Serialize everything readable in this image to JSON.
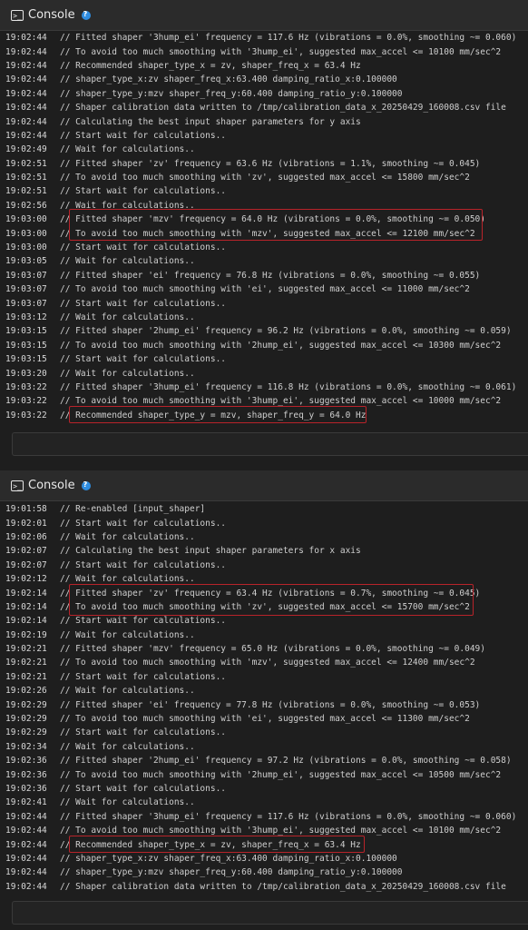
{
  "panel1": {
    "title": "Console",
    "lines": [
      {
        "ts": "19:02:44",
        "msg": "// Fitted shaper '3hump_ei' frequency = 117.6 Hz (vibrations = 0.0%, smoothing ~= 0.060)"
      },
      {
        "ts": "19:02:44",
        "msg": "// To avoid too much smoothing with '3hump_ei', suggested max_accel <= 10100 mm/sec^2"
      },
      {
        "ts": "19:02:44",
        "msg": "// Recommended shaper_type_x = zv, shaper_freq_x = 63.4 Hz"
      },
      {
        "ts": "19:02:44",
        "msg": "// shaper_type_x:zv shaper_freq_x:63.400 damping_ratio_x:0.100000"
      },
      {
        "ts": "19:02:44",
        "msg": "// shaper_type_y:mzv shaper_freq_y:60.400 damping_ratio_y:0.100000"
      },
      {
        "ts": "19:02:44",
        "msg": "// Shaper calibration data written to /tmp/calibration_data_x_20250429_160008.csv file"
      },
      {
        "ts": "19:02:44",
        "msg": "// Calculating the best input shaper parameters for y axis"
      },
      {
        "ts": "19:02:44",
        "msg": "// Start wait for calculations.."
      },
      {
        "ts": "19:02:49",
        "msg": "// Wait for calculations.."
      },
      {
        "ts": "19:02:51",
        "msg": "// Fitted shaper 'zv' frequency = 63.6 Hz (vibrations = 1.1%, smoothing ~= 0.045)"
      },
      {
        "ts": "19:02:51",
        "msg": "// To avoid too much smoothing with 'zv', suggested max_accel <= 15800 mm/sec^2"
      },
      {
        "ts": "19:02:51",
        "msg": "// Start wait for calculations.."
      },
      {
        "ts": "19:02:56",
        "msg": "// Wait for calculations.."
      },
      {
        "ts": "19:03:00",
        "msg": "// Fitted shaper 'mzv' frequency = 64.0 Hz (vibrations = 0.0%, smoothing ~= 0.050)"
      },
      {
        "ts": "19:03:00",
        "msg": "// To avoid too much smoothing with 'mzv', suggested max_accel <= 12100 mm/sec^2"
      },
      {
        "ts": "19:03:00",
        "msg": "// Start wait for calculations.."
      },
      {
        "ts": "19:03:05",
        "msg": "// Wait for calculations.."
      },
      {
        "ts": "19:03:07",
        "msg": "// Fitted shaper 'ei' frequency = 76.8 Hz (vibrations = 0.0%, smoothing ~= 0.055)"
      },
      {
        "ts": "19:03:07",
        "msg": "// To avoid too much smoothing with 'ei', suggested max_accel <= 11000 mm/sec^2"
      },
      {
        "ts": "19:03:07",
        "msg": "// Start wait for calculations.."
      },
      {
        "ts": "19:03:12",
        "msg": "// Wait for calculations.."
      },
      {
        "ts": "19:03:15",
        "msg": "// Fitted shaper '2hump_ei' frequency = 96.2 Hz (vibrations = 0.0%, smoothing ~= 0.059)"
      },
      {
        "ts": "19:03:15",
        "msg": "// To avoid too much smoothing with '2hump_ei', suggested max_accel <= 10300 mm/sec^2"
      },
      {
        "ts": "19:03:15",
        "msg": "// Start wait for calculations.."
      },
      {
        "ts": "19:03:20",
        "msg": "// Wait for calculations.."
      },
      {
        "ts": "19:03:22",
        "msg": "// Fitted shaper '3hump_ei' frequency = 116.8 Hz (vibrations = 0.0%, smoothing ~= 0.061)"
      },
      {
        "ts": "19:03:22",
        "msg": "// To avoid too much smoothing with '3hump_ei', suggested max_accel <= 10000 mm/sec^2"
      },
      {
        "ts": "19:03:22",
        "msg": "// Recommended shaper_type_y = mzv, shaper_freq_y = 64.0 Hz"
      }
    ]
  },
  "panel2": {
    "title": "Console",
    "lines": [
      {
        "ts": "19:01:58",
        "msg": "// Re-enabled [input_shaper]"
      },
      {
        "ts": "19:02:01",
        "msg": "// Start wait for calculations.."
      },
      {
        "ts": "19:02:06",
        "msg": "// Wait for calculations.."
      },
      {
        "ts": "19:02:07",
        "msg": "// Calculating the best input shaper parameters for x axis"
      },
      {
        "ts": "19:02:07",
        "msg": "// Start wait for calculations.."
      },
      {
        "ts": "19:02:12",
        "msg": "// Wait for calculations.."
      },
      {
        "ts": "19:02:14",
        "msg": "// Fitted shaper 'zv' frequency = 63.4 Hz (vibrations = 0.7%, smoothing ~= 0.045)"
      },
      {
        "ts": "19:02:14",
        "msg": "// To avoid too much smoothing with 'zv', suggested max_accel <= 15700 mm/sec^2"
      },
      {
        "ts": "19:02:14",
        "msg": "// Start wait for calculations.."
      },
      {
        "ts": "19:02:19",
        "msg": "// Wait for calculations.."
      },
      {
        "ts": "19:02:21",
        "msg": "// Fitted shaper 'mzv' frequency = 65.0 Hz (vibrations = 0.0%, smoothing ~= 0.049)"
      },
      {
        "ts": "19:02:21",
        "msg": "// To avoid too much smoothing with 'mzv', suggested max_accel <= 12400 mm/sec^2"
      },
      {
        "ts": "19:02:21",
        "msg": "// Start wait for calculations.."
      },
      {
        "ts": "19:02:26",
        "msg": "// Wait for calculations.."
      },
      {
        "ts": "19:02:29",
        "msg": "// Fitted shaper 'ei' frequency = 77.8 Hz (vibrations = 0.0%, smoothing ~= 0.053)"
      },
      {
        "ts": "19:02:29",
        "msg": "// To avoid too much smoothing with 'ei', suggested max_accel <= 11300 mm/sec^2"
      },
      {
        "ts": "19:02:29",
        "msg": "// Start wait for calculations.."
      },
      {
        "ts": "19:02:34",
        "msg": "// Wait for calculations.."
      },
      {
        "ts": "19:02:36",
        "msg": "// Fitted shaper '2hump_ei' frequency = 97.2 Hz (vibrations = 0.0%, smoothing ~= 0.058)"
      },
      {
        "ts": "19:02:36",
        "msg": "// To avoid too much smoothing with '2hump_ei', suggested max_accel <= 10500 mm/sec^2"
      },
      {
        "ts": "19:02:36",
        "msg": "// Start wait for calculations.."
      },
      {
        "ts": "19:02:41",
        "msg": "// Wait for calculations.."
      },
      {
        "ts": "19:02:44",
        "msg": "// Fitted shaper '3hump_ei' frequency = 117.6 Hz (vibrations = 0.0%, smoothing ~= 0.060)"
      },
      {
        "ts": "19:02:44",
        "msg": "// To avoid too much smoothing with '3hump_ei', suggested max_accel <= 10100 mm/sec^2"
      },
      {
        "ts": "19:02:44",
        "msg": "// Recommended shaper_type_x = zv, shaper_freq_x = 63.4 Hz"
      },
      {
        "ts": "19:02:44",
        "msg": "// shaper_type_x:zv shaper_freq_x:63.400 damping_ratio_x:0.100000"
      },
      {
        "ts": "19:02:44",
        "msg": "// shaper_type_y:mzv shaper_freq_y:60.400 damping_ratio_y:0.100000"
      },
      {
        "ts": "19:02:44",
        "msg": "// Shaper calibration data written to /tmp/calibration_data_x_20250429_160008.csv file"
      }
    ]
  },
  "colors": {
    "highlight_border": "#b8232a",
    "help_icon": "#2f8de0",
    "background": "#1e1e1e"
  },
  "icons": {
    "console": "terminal-icon",
    "help": "help-icon"
  }
}
